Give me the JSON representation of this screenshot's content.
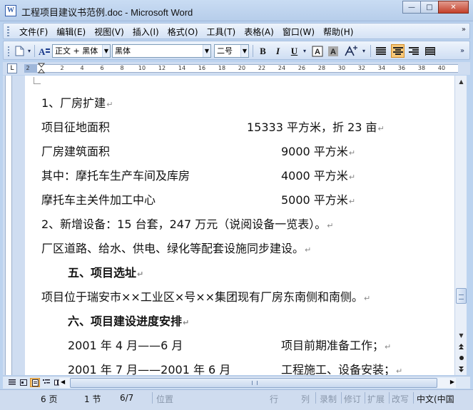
{
  "window": {
    "title": "工程项目建议书范例.doc - Microsoft Word",
    "app_icon": "W",
    "buttons": {
      "minimize": "—",
      "maximize": "□",
      "close": "✕"
    }
  },
  "menu": {
    "items": [
      "文件(F)",
      "编辑(E)",
      "视图(V)",
      "插入(I)",
      "格式(O)",
      "工具(T)",
      "表格(A)",
      "窗口(W)",
      "帮助(H)"
    ],
    "more": "»"
  },
  "toolbar": {
    "style": "正文 + 黑体",
    "font": "黑体",
    "size": "二号",
    "bold": "B",
    "italic": "I",
    "underline": "U",
    "more": "»"
  },
  "ruler": {
    "corner": "L",
    "ticks": [
      "2",
      "2",
      "4",
      "6",
      "8",
      "10",
      "12",
      "14",
      "16",
      "18",
      "20",
      "22",
      "24",
      "26",
      "28",
      "30",
      "32",
      "34",
      "36",
      "38",
      "40"
    ]
  },
  "document": {
    "lines": [
      {
        "text": "1、厂房扩建",
        "value": ""
      },
      {
        "text": "项目征地面积",
        "value": "15333 平方米，折 23 亩"
      },
      {
        "text": "厂房建筑面积",
        "value": "9000 平方米"
      },
      {
        "text": "其中：摩托车生产车间及库房",
        "value": "4000 平方米"
      },
      {
        "text": "摩托车主关件加工中心",
        "value": "5000 平方米"
      },
      {
        "text": "2、新增设备：15 台套，247 万元（说阅设备一览表）。",
        "value": ""
      },
      {
        "text": "厂区道路、给水、供电、绿化等配套设施同步建设。",
        "value": ""
      },
      {
        "text": "五、项目选址",
        "value": ""
      },
      {
        "text": "项目位于瑞安市××工业区×号××集团现有厂房东南侧和南侧。",
        "value": ""
      },
      {
        "text": "六、项目建设进度安排",
        "value": ""
      },
      {
        "text": "2001 年 4 月——6 月",
        "value": "项目前期准备工作；"
      },
      {
        "text": "2001 年 7 月——2001 年 6 月",
        "value": "工程施工、设备安装；"
      }
    ],
    "paragraph_mark": "↵"
  },
  "status": {
    "page": "6 页",
    "section": "1 节",
    "page_of": "6/7",
    "position": "位置",
    "row": "行",
    "col": "列",
    "rec": "录制",
    "trk": "修订",
    "ext": "扩展",
    "ovr": "改写",
    "lang": "中文(中国"
  }
}
